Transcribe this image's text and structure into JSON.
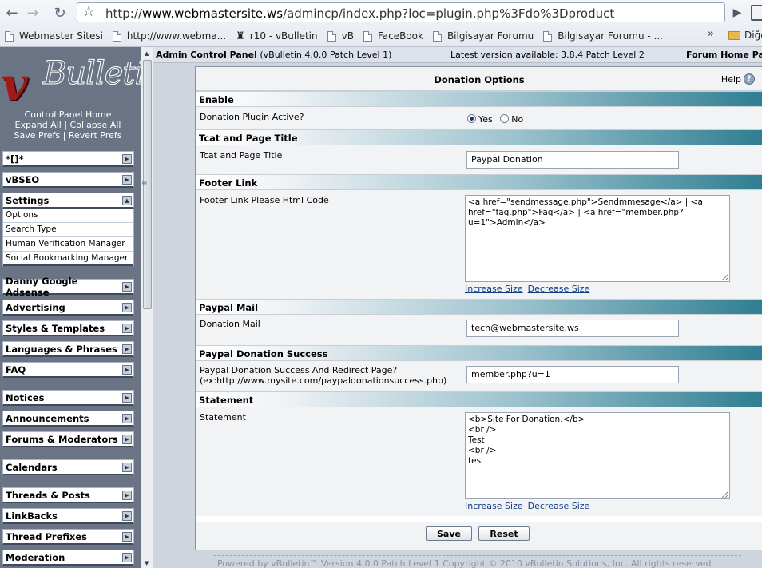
{
  "browser": {
    "url_prefix": "http://",
    "url_host": "www.webmastersite.ws",
    "url_path": "/admincp/index.php?loc=plugin.php%3Fdo%3Dproduct",
    "bookmarks": [
      "Webmaster Sitesi",
      "http://www.webma...",
      "r10 - vBulletin",
      "vB",
      "FaceBook",
      "Bilgisayar Forumu",
      "Bilgisayar Forumu - ..."
    ],
    "bookmarks_overflow": "»",
    "other_bookmarks": "Diğe"
  },
  "nav": {
    "logo_text": "vBulletin",
    "control_panel_home": "Control Panel Home",
    "expand_all": "Expand All",
    "collapse_all": "Collapse All",
    "save_prefs": "Save Prefs",
    "revert_prefs": "Revert Prefs",
    "sep": "|",
    "groups": [
      "*[]*",
      "vBSEO",
      "Settings",
      "Danny Google Adsense",
      "Advertising",
      "Styles & Templates",
      "Languages & Phrases",
      "FAQ",
      "Notices",
      "Announcements",
      "Forums & Moderators",
      "Calendars",
      "Threads & Posts",
      "LinkBacks",
      "Thread Prefixes",
      "Moderation"
    ],
    "settings_items": [
      "Options",
      "Search Type",
      "Human Verification Manager",
      "Social Bookmarking Manager"
    ]
  },
  "topbar": {
    "title": "Admin Control Panel",
    "version": "(vBulletin 4.0.0 Patch Level 1)",
    "latest": "Latest version available: 3.8.4 Patch Level 2",
    "forum_home": "Forum Home Pag"
  },
  "panel": {
    "title": "Donation Options",
    "help": "Help",
    "sections": {
      "enable": "Enable",
      "tcat": "Tcat and Page Title",
      "footer": "Footer Link",
      "mail": "Paypal Mail",
      "success": "Paypal Donation Success",
      "statement": "Statement"
    },
    "fields": {
      "active_label": "Donation Plugin Active?",
      "yes": "Yes",
      "no": "No",
      "tcat_label": "Tcat and Page Title",
      "tcat_value": "Paypal Donation",
      "footer_label": "Footer Link Please Html Code",
      "footer_value": "<a href=\"sendmessage.php\">Sendmmesage</a> | <a href=\"faq.php\">Faq</a> | <a href=\"member.php?u=1\">Admin</a>",
      "mail_label": "Donation Mail",
      "mail_value": "tech@webmastersite.ws",
      "success_label_1": "Paypal Donation Success And Redirect Page?",
      "success_label_2": "(ex:http://www.mysite.com/paypaldonationsuccess.php)",
      "success_value": "member.php?u=1",
      "statement_label": "Statement",
      "statement_value": "<b>Site For Donation.</b>\n<br />\nTest\n<br />\ntest"
    },
    "increase_size": "Increase Size",
    "decrease_size": "Decrease Size",
    "save": "Save",
    "reset": "Reset"
  },
  "footer": "Powered by vBulletin™ Version 4.0.0 Patch Level 1 Copyright © 2010 vBulletin Solutions, Inc. All rights reserved."
}
